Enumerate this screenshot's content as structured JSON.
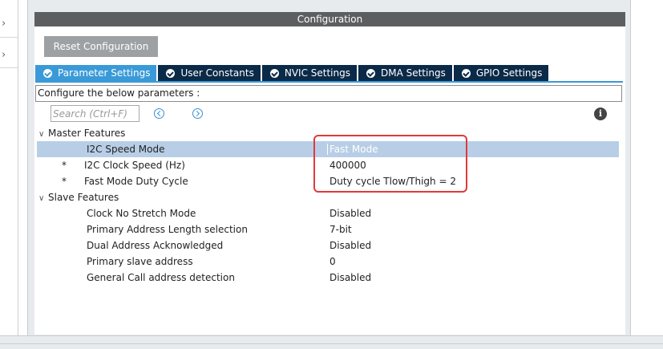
{
  "config_title": "Configuration",
  "reset_button": "Reset Configuration",
  "tabs": [
    {
      "label": "Parameter Settings",
      "active": true
    },
    {
      "label": "User Constants",
      "active": false
    },
    {
      "label": "NVIC Settings",
      "active": false
    },
    {
      "label": "DMA Settings",
      "active": false
    },
    {
      "label": "GPIO Settings",
      "active": false
    }
  ],
  "configure_label": "Configure the below parameters :",
  "search": {
    "placeholder": "Search (Ctrl+F)",
    "value": ""
  },
  "groups": {
    "master": {
      "label": "Master Features",
      "params": [
        {
          "name": "I2C Speed Mode",
          "value": "Fast Mode",
          "required": false,
          "selected": true
        },
        {
          "name": "I2C Clock Speed (Hz)",
          "value": "400000",
          "required": true,
          "selected": false
        },
        {
          "name": "Fast Mode Duty Cycle",
          "value": "Duty cycle Tlow/Thigh = 2",
          "required": true,
          "selected": false
        }
      ]
    },
    "slave": {
      "label": "Slave Features",
      "params": [
        {
          "name": "Clock No Stretch Mode",
          "value": "Disabled"
        },
        {
          "name": "Primary Address Length selection",
          "value": "7-bit"
        },
        {
          "name": "Dual Address Acknowledged",
          "value": "Disabled"
        },
        {
          "name": "Primary slave address",
          "value": "0"
        },
        {
          "name": "General Call address detection",
          "value": "Disabled"
        }
      ]
    }
  },
  "required_marker": "*",
  "info_glyph": "i",
  "colors": {
    "tab_active": "#3a9ad8",
    "tab_inactive": "#0b2a48",
    "selected_row": "#b7cee6",
    "highlight": "#e0393b"
  }
}
